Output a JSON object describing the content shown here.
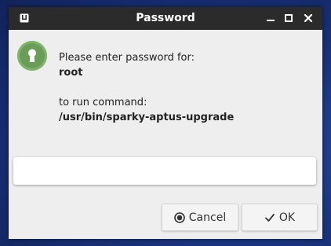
{
  "window": {
    "title": "Password"
  },
  "dialog": {
    "prompt_line": "Please enter password for:",
    "user": "root",
    "command_label": "to run command:",
    "command": "/usr/bin/sparky-aptus-upgrade",
    "password_value": ""
  },
  "buttons": {
    "cancel_label": "Cancel",
    "ok_label": "OK"
  },
  "icons": {
    "lock": "keyhole-icon",
    "app": "app-icon",
    "cancel": "cancel-circle-icon",
    "ok": "checkmark-icon"
  },
  "colors": {
    "titlebar": "#2b2b2b",
    "dialog_bg": "#eeeeee",
    "lock_green": "#6a9e58",
    "desktop": "#1b3580"
  }
}
